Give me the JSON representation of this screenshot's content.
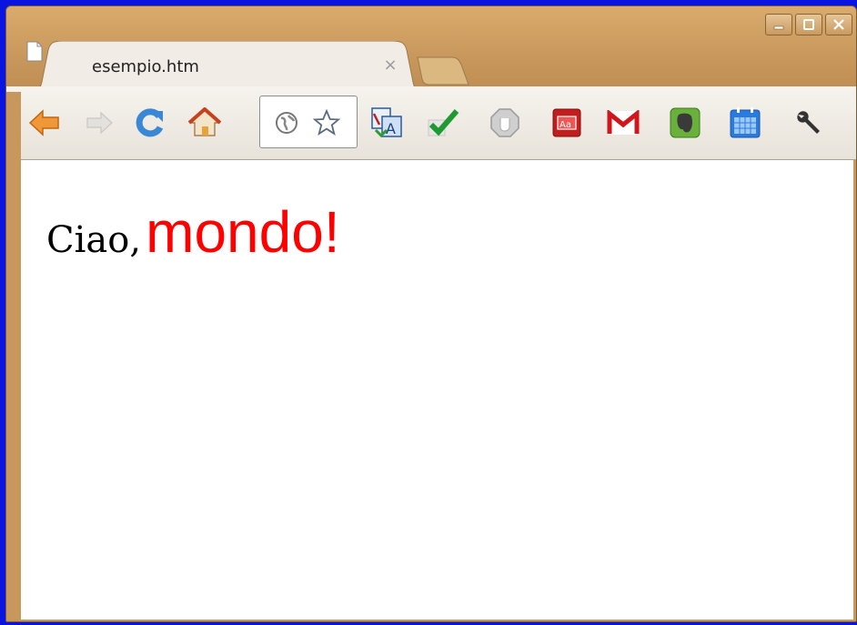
{
  "tab": {
    "title": "esempio.htm",
    "close_glyph": "×"
  },
  "window_controls": {
    "minimize": "minimize-icon",
    "maximize": "maximize-icon",
    "close": "close-icon"
  },
  "toolbar": {
    "buttons": [
      "back-arrow-icon",
      "forward-arrow-icon",
      "reload-icon",
      "home-icon"
    ],
    "omnibox_icons": [
      "globe-icon",
      "star-icon"
    ],
    "extensions": [
      "translate-icon",
      "checkmark-icon",
      "block-icon",
      "dictionary-icon",
      "gmail-icon",
      "evernote-icon",
      "calendar-icon",
      "wrench-icon"
    ]
  },
  "page": {
    "word1": "Ciao,",
    "word2": "mondo!"
  },
  "colors": {
    "frame": "#c8975c",
    "desktop": "#0a14e0",
    "mondo": "#ff0000"
  }
}
